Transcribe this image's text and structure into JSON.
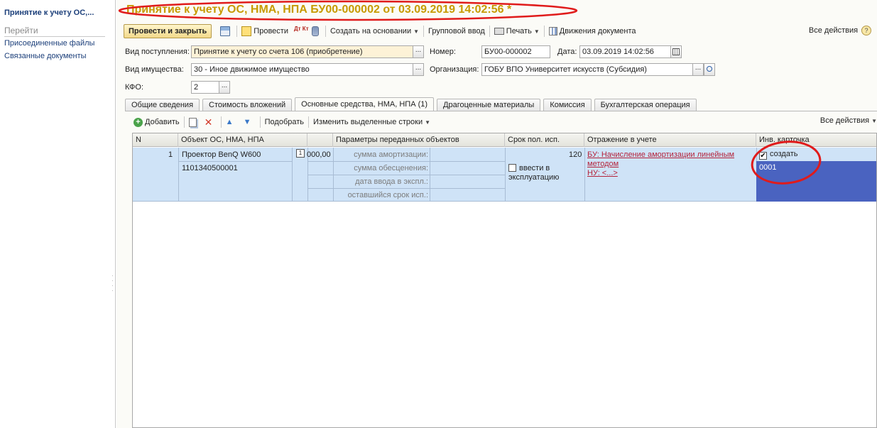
{
  "left_panel": {
    "title": "Принятие к учету ОС,...",
    "section": "Перейти",
    "links": [
      "Присоединенные файлы",
      "Связанные документы"
    ]
  },
  "document": {
    "title": "Принятие к учету ОС, НМА, НПА БУ00-000002 от 03.09.2019 14:02:56 *"
  },
  "toolbar": {
    "post_close": "Провести и закрыть",
    "post": "Провести",
    "dt_kt": "Дт Кт",
    "create_based": "Создать на основании",
    "group_input": "Групповой ввод",
    "print": "Печать",
    "movements": "Движения документа",
    "all_actions": "Все действия",
    "help": "?"
  },
  "form": {
    "receipt_type_label": "Вид поступления:",
    "receipt_type_value": "Принятие к учету со счета 106 (приобретение)",
    "number_label": "Номер:",
    "number_value": "БУ00-000002",
    "date_label": "Дата:",
    "date_value": "03.09.2019 14:02:56",
    "property_type_label": "Вид имущества:",
    "property_type_value": "30 - Иное движимое имущество",
    "organization_label": "Организация:",
    "organization_value": "ГОБУ ВПО Университет искусств (Субсидия)",
    "kfo_label": "КФО:",
    "kfo_value": "2",
    "choose_btn": "..."
  },
  "tabs": [
    {
      "label": "Общие сведения",
      "active": false
    },
    {
      "label": "Стоимость вложений",
      "active": false
    },
    {
      "label": "Основные средства, НМА, НПА (1)",
      "active": true
    },
    {
      "label": "Драгоценные материалы",
      "active": false
    },
    {
      "label": "Комиссия",
      "active": false
    },
    {
      "label": "Бухгалтерская операция",
      "active": false
    }
  ],
  "table_toolbar": {
    "add": "Добавить",
    "pick": "Подобрать",
    "edit_selected": "Изменить выделенные строки",
    "all_actions": "Все действия"
  },
  "table": {
    "headers": {
      "n": "N",
      "object": "Объект ОС, НМА, НПА",
      "params": "Параметры переданных объектов",
      "life": "Срок пол. исп.",
      "accounting": "Отражение в учете",
      "inv_card": "Инв. карточка"
    },
    "row": {
      "n": "1",
      "object_name": "Проектор BenQ W600",
      "object_code": "1101340500001",
      "ref_marker": "1",
      "amount": "000,00",
      "param_labels": [
        "сумма амортизации:",
        "сумма обесценения:",
        "дата ввода в экспл.:",
        "оставшийся срок исп.:"
      ],
      "life_value": "120",
      "commission_label": "ввести в эксплуатацию",
      "commission_checked": false,
      "bu_link": "БУ: Начисление амортизации линейным методом",
      "nu_link": "НУ: <...>",
      "create_label": "создать",
      "create_checked": true,
      "inv_number": "0001"
    }
  },
  "colors": {
    "title": "#c79a00",
    "row_bg": "#cfe3f7",
    "selected": "#4a63c0",
    "link": "#b4233a",
    "annotation": "#e01b1b"
  }
}
